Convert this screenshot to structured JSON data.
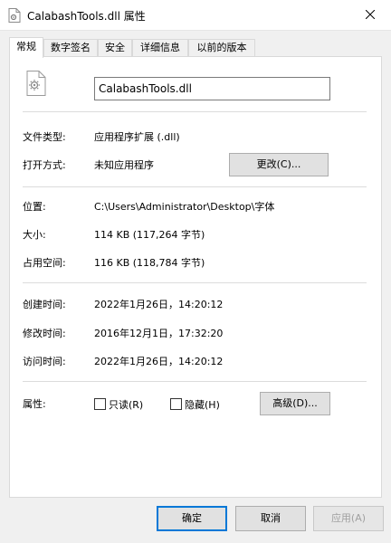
{
  "window": {
    "title": "CalabashTools.dll 属性"
  },
  "tabs": [
    {
      "label": "常规"
    },
    {
      "label": "数字签名"
    },
    {
      "label": "安全"
    },
    {
      "label": "详细信息"
    },
    {
      "label": "以前的版本"
    }
  ],
  "general": {
    "file_name": "CalabashTools.dll",
    "file_type_label": "文件类型:",
    "file_type_value": "应用程序扩展 (.dll)",
    "open_with_label": "打开方式:",
    "open_with_value": "未知应用程序",
    "change_button": "更改(C)...",
    "location_label": "位置:",
    "location_value": "C:\\Users\\Administrator\\Desktop\\字体",
    "size_label": "大小:",
    "size_value": "114 KB (117,264 字节)",
    "disk_size_label": "占用空间:",
    "disk_size_value": "116 KB (118,784 字节)",
    "created_label": "创建时间:",
    "created_value": "2022年1月26日，14:20:12",
    "modified_label": "修改时间:",
    "modified_value": "2016年12月1日，17:32:20",
    "accessed_label": "访问时间:",
    "accessed_value": "2022年1月26日，14:20:12",
    "attributes_label": "属性:",
    "readonly_label": "只读(R)",
    "readonly_checked": false,
    "hidden_label": "隐藏(H)",
    "hidden_checked": false,
    "advanced_button": "高级(D)..."
  },
  "footer": {
    "ok_button": "确定",
    "cancel_button": "取消",
    "apply_button": "应用(A)"
  },
  "colors": {
    "accent": "#0078d7",
    "background": "#f0f0f0",
    "panel": "#ffffff"
  }
}
